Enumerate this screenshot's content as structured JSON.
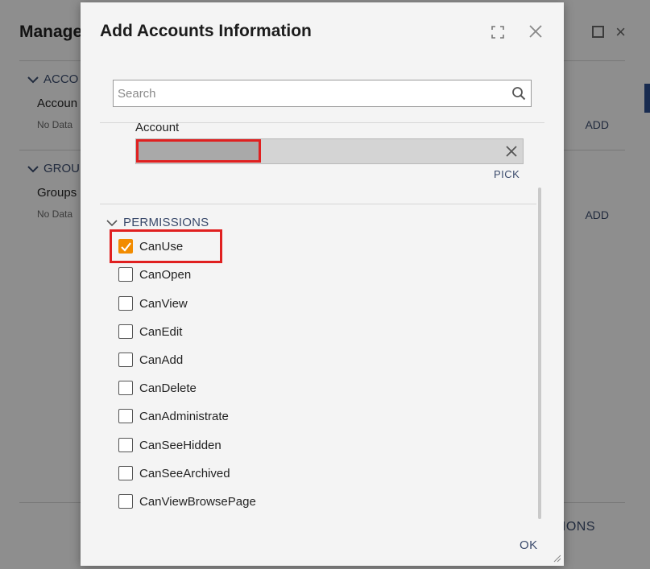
{
  "background": {
    "title": "Manage",
    "sections": [
      {
        "label": "ACCO",
        "sub": "Accoun",
        "nodata": "No Data",
        "add": "ADD"
      },
      {
        "label": "GROU",
        "sub": "Groups",
        "nodata": "No Data",
        "add": "ADD"
      }
    ],
    "bottom_label": "IONS"
  },
  "modal": {
    "title": "Add Accounts Information",
    "search": {
      "placeholder": "Search",
      "value": ""
    },
    "account": {
      "label": "Account",
      "pick_label": "PICK"
    },
    "permissions": {
      "header": "PERMISSIONS",
      "items": [
        {
          "label": "CanUse",
          "checked": true
        },
        {
          "label": "CanOpen",
          "checked": false
        },
        {
          "label": "CanView",
          "checked": false
        },
        {
          "label": "CanEdit",
          "checked": false
        },
        {
          "label": "CanAdd",
          "checked": false
        },
        {
          "label": "CanDelete",
          "checked": false
        },
        {
          "label": "CanAdministrate",
          "checked": false
        },
        {
          "label": "CanSeeHidden",
          "checked": false
        },
        {
          "label": "CanSeeArchived",
          "checked": false
        },
        {
          "label": "CanViewBrowsePage",
          "checked": false
        }
      ]
    },
    "ok_label": "OK"
  },
  "colors": {
    "accent": "#f28c00",
    "highlight": "#e02020",
    "link": "#3a4a6b"
  },
  "icons": [
    "expand-icon",
    "close-icon",
    "search-icon",
    "clear-icon",
    "chevron-down-icon",
    "checkmark-icon",
    "resize-handle-icon"
  ]
}
